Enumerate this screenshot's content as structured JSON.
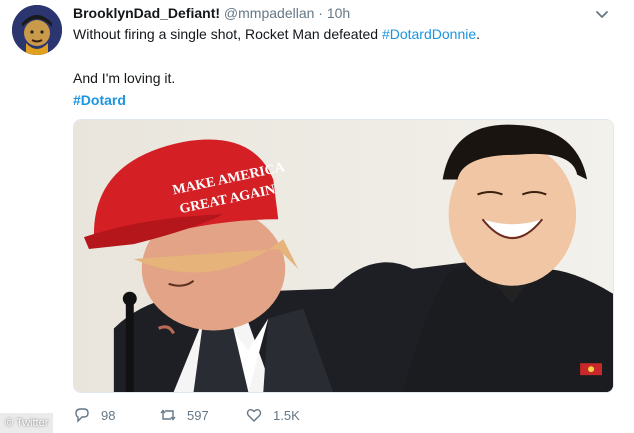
{
  "tweet": {
    "display_name": "BrooklynDad_Defiant!",
    "handle": "@mmpadellan",
    "separator": "·",
    "time": "10h",
    "line1_text": "Without firing a single shot, Rocket Man defeated ",
    "line1_hashtag": "#DotardDonnie",
    "line1_end": ".",
    "line2_text": "And I'm loving it.",
    "line3_hashtag": "#Dotard",
    "media": {
      "hat_text_line1": "MAKE AMERICA",
      "hat_text_line2": "GREAT AGAIN"
    }
  },
  "actions": {
    "replies": "98",
    "retweets": "597",
    "likes": "1.5K"
  },
  "watermark": "© Twitter",
  "colors": {
    "link": "#1b95e0",
    "muted": "#657786",
    "text": "#14171a",
    "hat_red": "#d41f25"
  }
}
